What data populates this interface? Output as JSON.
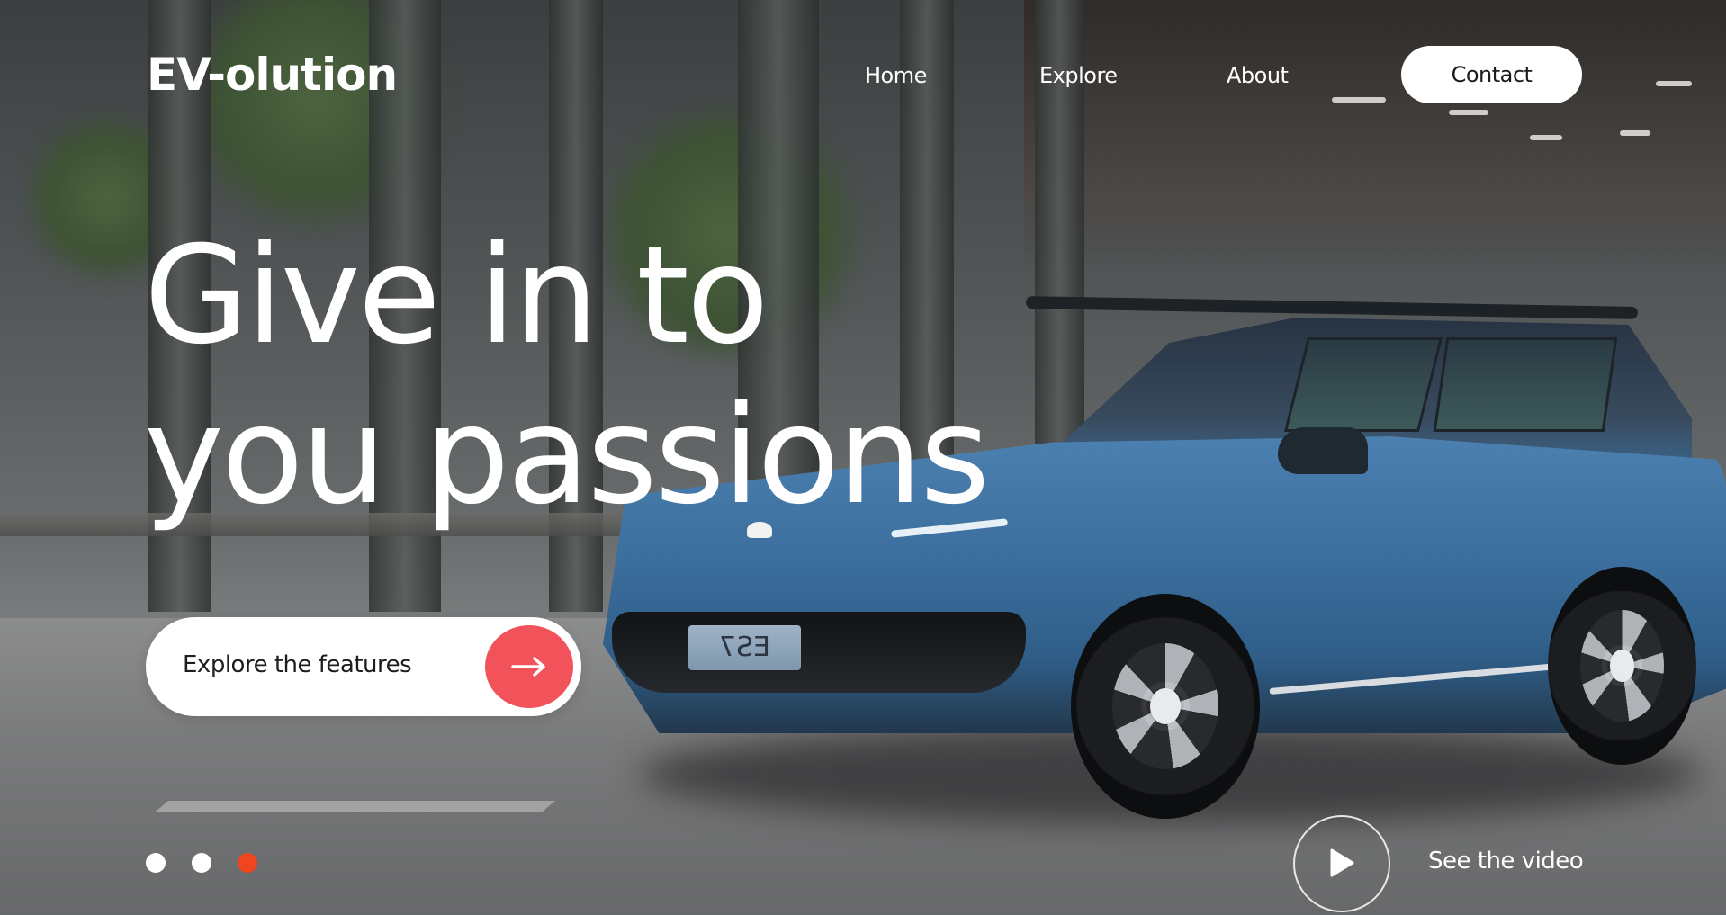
{
  "brand": {
    "name": "EV-olution"
  },
  "nav": {
    "items": [
      {
        "label": "Home"
      },
      {
        "label": "Explore"
      },
      {
        "label": "About"
      }
    ],
    "contact_label": "Contact"
  },
  "hero": {
    "headline_line1": "Give in to",
    "headline_line2": "you passions",
    "cta_label": "Explore the features",
    "cta_icon": "arrow-right-icon",
    "video_label": "See the video",
    "video_icon": "play-icon",
    "car_plate": "ES7"
  },
  "carousel": {
    "slide_count": 3,
    "active_index": 2
  },
  "colors": {
    "accent": "#f2525a",
    "active_dot": "#f0461e",
    "inactive_dot": "#ffffff",
    "text": "#ffffff",
    "button_bg": "#ffffff",
    "car_body": "#3c6f9e"
  }
}
